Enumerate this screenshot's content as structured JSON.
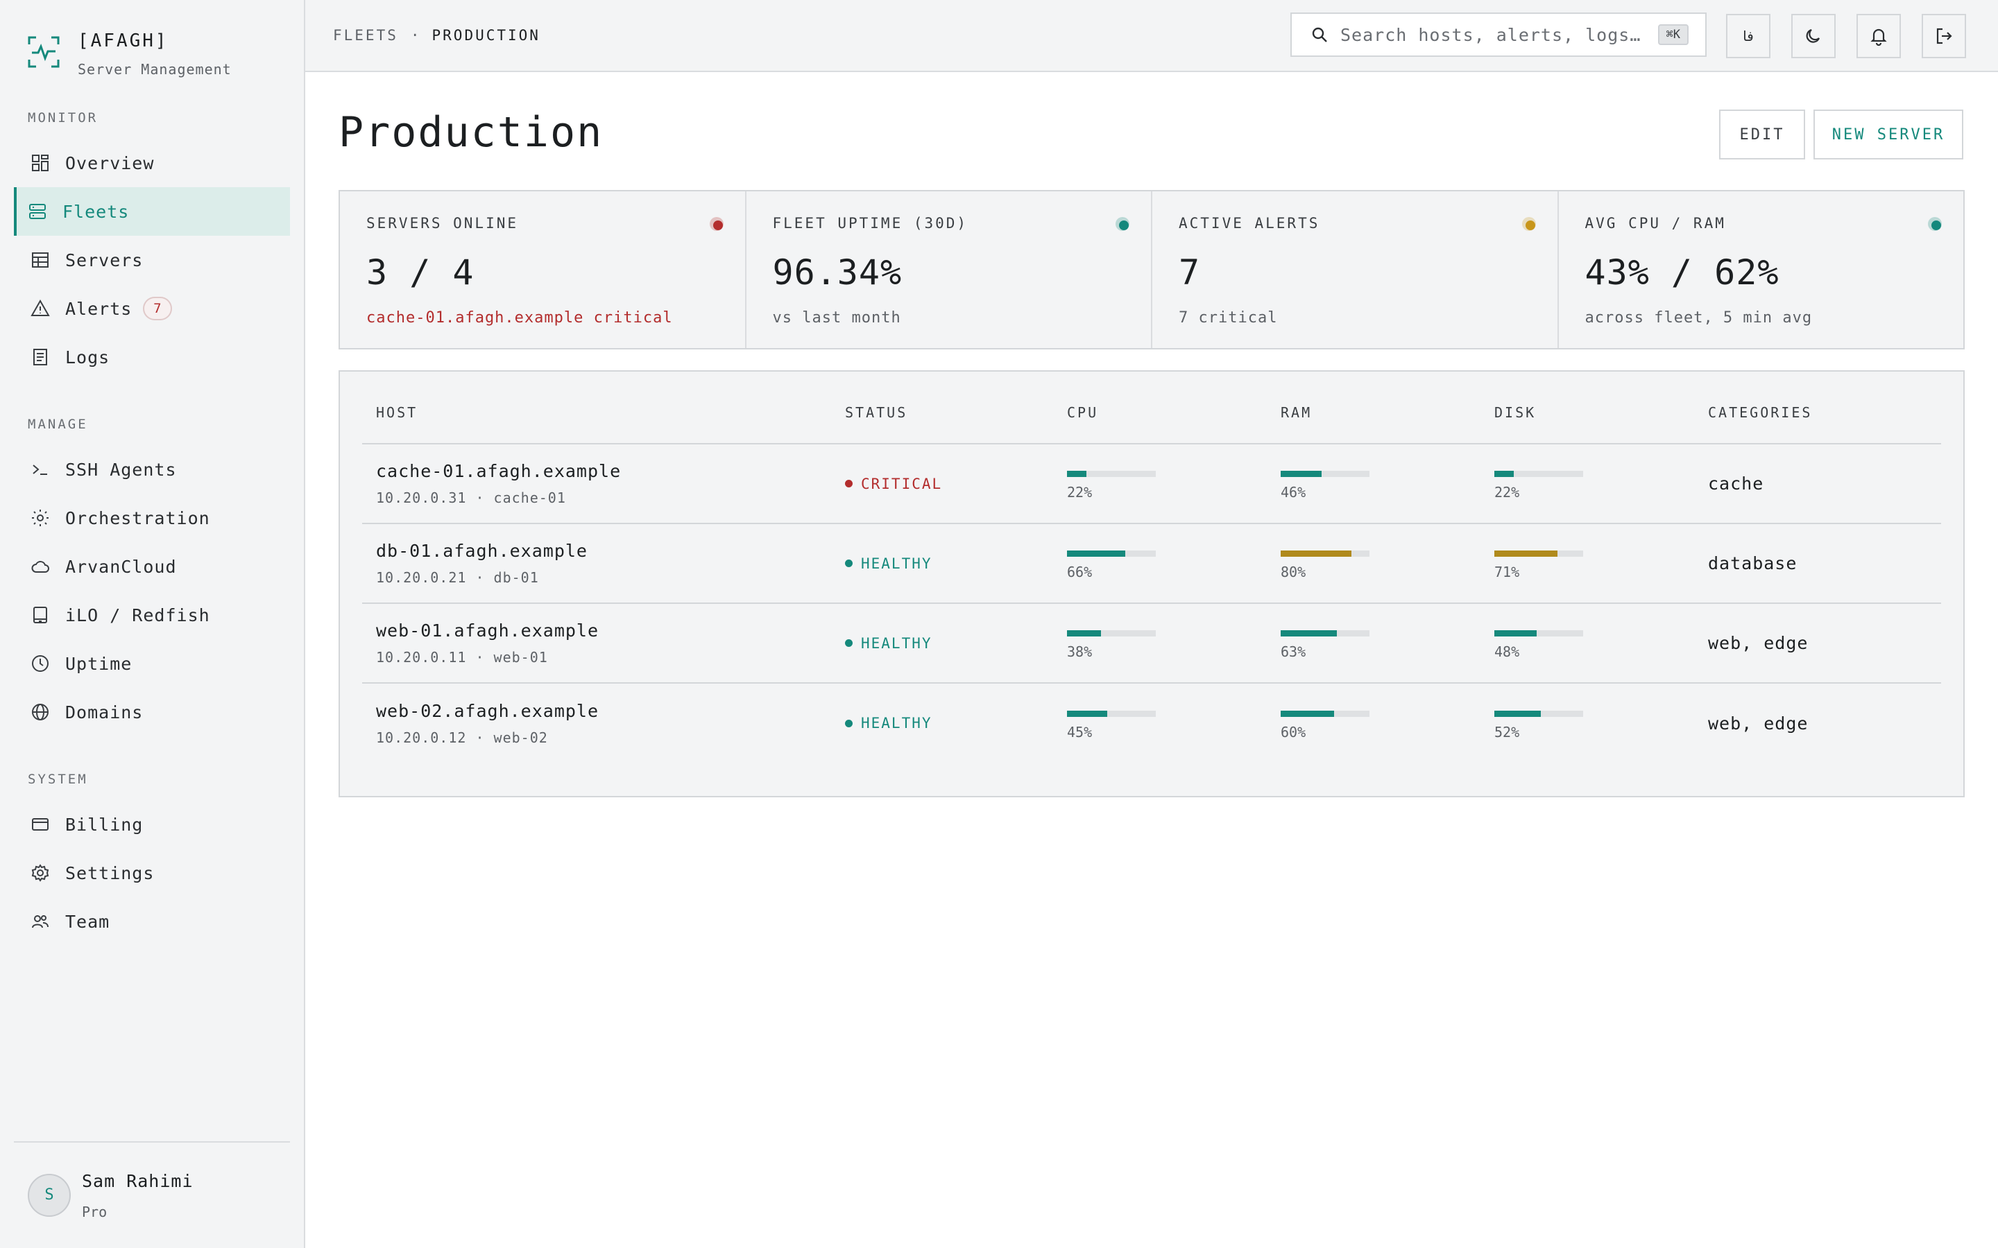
{
  "brand": {
    "title": "[AFAGH]",
    "subtitle": "Server Management"
  },
  "nav": {
    "sections": [
      {
        "label": "MONITOR",
        "items": [
          {
            "label": "Overview",
            "icon": "grid-icon"
          },
          {
            "label": "Fleets",
            "icon": "server-stack-icon",
            "active": true
          },
          {
            "label": "Servers",
            "icon": "table-icon"
          },
          {
            "label": "Alerts",
            "icon": "warning-icon",
            "badge": "7"
          },
          {
            "label": "Logs",
            "icon": "document-icon"
          }
        ]
      },
      {
        "label": "MANAGE",
        "items": [
          {
            "label": "SSH Agents",
            "icon": "terminal-icon"
          },
          {
            "label": "Orchestration",
            "icon": "sun-gear-icon"
          },
          {
            "label": "ArvanCloud",
            "icon": "cloud-icon"
          },
          {
            "label": "iLO / Redfish",
            "icon": "book-icon"
          },
          {
            "label": "Uptime",
            "icon": "clock-icon"
          },
          {
            "label": "Domains",
            "icon": "globe-icon"
          }
        ]
      },
      {
        "label": "SYSTEM",
        "items": [
          {
            "label": "Billing",
            "icon": "credit-card-icon"
          },
          {
            "label": "Settings",
            "icon": "gear-icon"
          },
          {
            "label": "Team",
            "icon": "users-icon"
          }
        ]
      }
    ]
  },
  "user": {
    "initial": "S",
    "name": "Sam Rahimi",
    "plan": "Pro"
  },
  "topbar": {
    "breadcrumb": {
      "parent": "FLEETS",
      "separator": "·",
      "current": "PRODUCTION"
    },
    "search": {
      "placeholder": "Search hosts, alerts, logs…",
      "shortcut": "⌘K"
    },
    "language_label": "فا"
  },
  "page": {
    "title": "Production",
    "edit_label": "EDIT",
    "new_server_label": "NEW SERVER"
  },
  "stats": [
    {
      "label": "SERVERS ONLINE",
      "value": "3 / 4",
      "sub": "cache-01.afagh.example critical",
      "dot_color": "#b32d2d",
      "sub_critical": true
    },
    {
      "label": "FLEET UPTIME (30D)",
      "value": "96.34%",
      "sub": "vs last month",
      "dot_color": "#15897c"
    },
    {
      "label": "ACTIVE ALERTS",
      "value": "7",
      "sub": "7 critical",
      "dot_color": "#c9961a"
    },
    {
      "label": "AVG CPU / RAM",
      "value": "43% / 62%",
      "sub": "across fleet, 5 min avg",
      "dot_color": "#15897c"
    }
  ],
  "table": {
    "headers": {
      "host": "HOST",
      "status": "STATUS",
      "cpu": "CPU",
      "ram": "RAM",
      "disk": "DISK",
      "categories": "CATEGORIES"
    },
    "rows": [
      {
        "host": "cache-01.afagh.example",
        "meta": "10.20.0.31 · cache-01",
        "status": "CRITICAL",
        "status_kind": "critical",
        "cpu": 22,
        "ram": 46,
        "disk": 22,
        "categories": "cache"
      },
      {
        "host": "db-01.afagh.example",
        "meta": "10.20.0.21 · db-01",
        "status": "HEALTHY",
        "status_kind": "healthy",
        "cpu": 66,
        "ram": 80,
        "disk": 71,
        "categories": "database"
      },
      {
        "host": "web-01.afagh.example",
        "meta": "10.20.0.11 · web-01",
        "status": "HEALTHY",
        "status_kind": "healthy",
        "cpu": 38,
        "ram": 63,
        "disk": 48,
        "categories": "web, edge"
      },
      {
        "host": "web-02.afagh.example",
        "meta": "10.20.0.12 · web-02",
        "status": "HEALTHY",
        "status_kind": "healthy",
        "cpu": 45,
        "ram": 60,
        "disk": 52,
        "categories": "web, edge"
      }
    ]
  },
  "colors": {
    "accent": "#15897c",
    "critical": "#b32d2d",
    "warning": "#b08a1c"
  }
}
